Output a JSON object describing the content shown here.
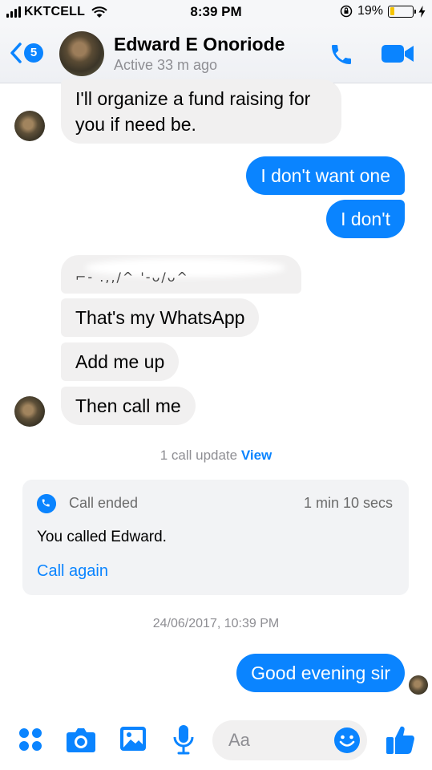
{
  "status_bar": {
    "carrier": "KKTCELL",
    "time": "8:39 PM",
    "battery_percent": "19%",
    "battery_level": 0.19,
    "icons": [
      "signal-bars-icon",
      "wifi-icon",
      "orientation-lock-icon",
      "battery-icon",
      "charging-bolt-icon"
    ]
  },
  "header": {
    "unread_count": "5",
    "contact_name": "Edward E Onoriode",
    "active_status": "Active 33 m ago",
    "icons": [
      "back-chevron-icon",
      "phone-icon",
      "video-camera-icon"
    ]
  },
  "messages": [
    {
      "direction": "incoming",
      "text": "I'll organize a fund raising for you if need be."
    },
    {
      "direction": "outgoing",
      "text": "I don't want one"
    },
    {
      "direction": "outgoing",
      "text": "I don't"
    },
    {
      "direction": "incoming",
      "text": "",
      "redacted": true
    },
    {
      "direction": "incoming",
      "text": "That's my WhatsApp"
    },
    {
      "direction": "incoming",
      "text": "Add me up"
    },
    {
      "direction": "incoming",
      "text": "Then call me"
    }
  ],
  "call_update": {
    "text": "1 call update",
    "link": "View"
  },
  "call_card": {
    "status": "Call ended",
    "duration": "1 min 10 secs",
    "description": "You called Edward.",
    "action": "Call again"
  },
  "timestamp": "24/06/2017, 10:39 PM",
  "last_message": {
    "direction": "outgoing",
    "text": "Good evening sir"
  },
  "composer": {
    "placeholder": "Aa",
    "icons": [
      "apps-grid-icon",
      "camera-icon",
      "image-icon",
      "microphone-icon",
      "emoji-icon",
      "thumbs-up-icon"
    ]
  },
  "colors": {
    "accent": "#0a84ff",
    "incoming_bubble": "#f1f0f0",
    "secondary_text": "#8e8e93",
    "battery_fill": "#f5c400"
  }
}
